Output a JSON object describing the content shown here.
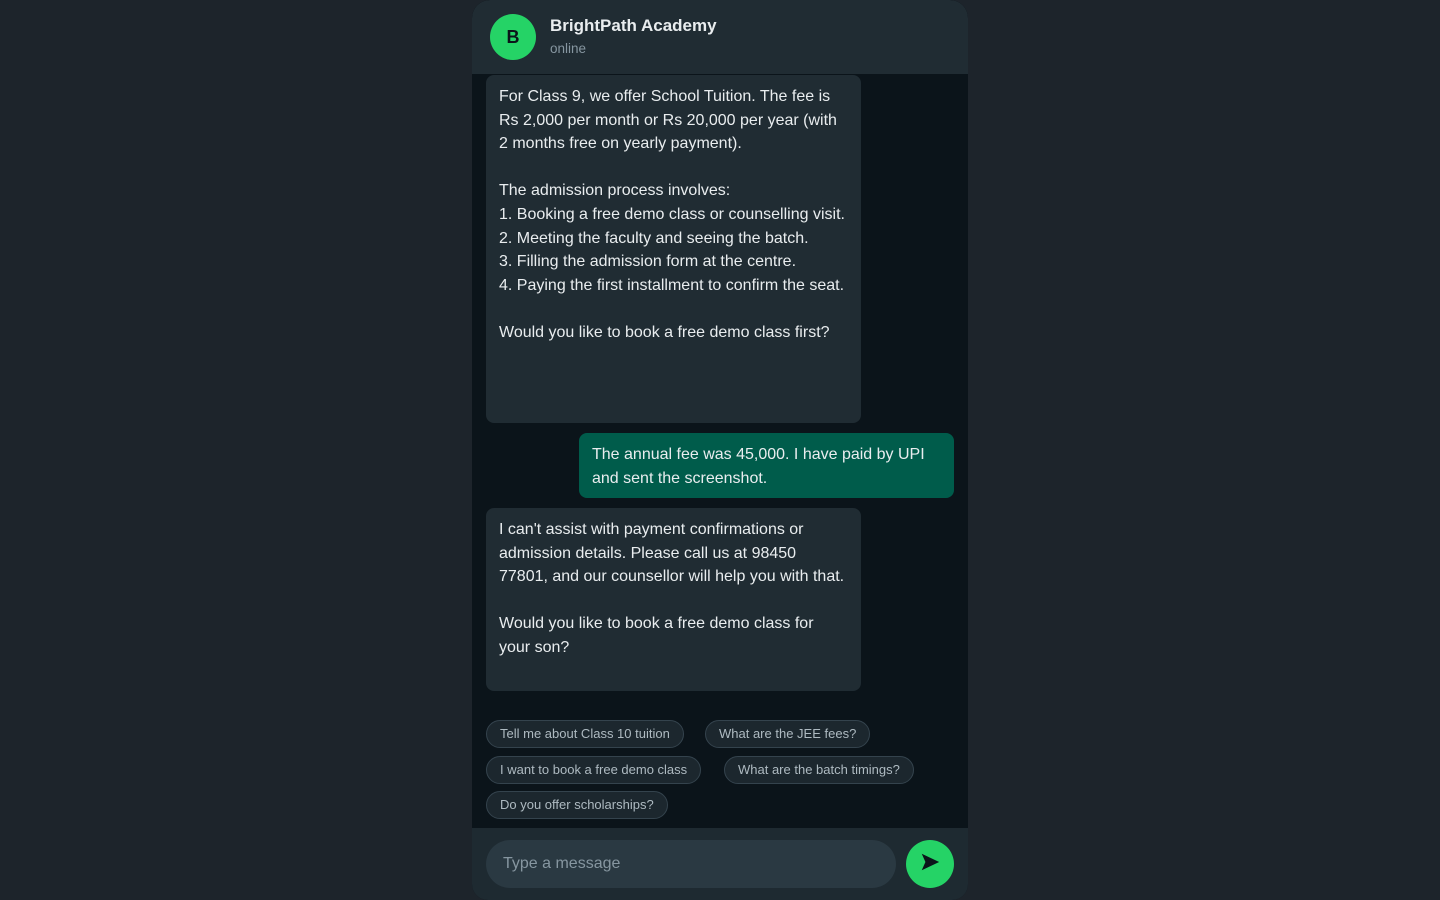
{
  "header": {
    "avatar_letter": "B",
    "title": "BrightPath Academy",
    "status": "online"
  },
  "messages": [
    {
      "from": "bot",
      "text": "For Class 9, we offer School Tuition. The fee is Rs 2,000 per month or Rs 20,000 per year (with 2 months free on yearly payment).\n\nThe admission process involves:\n1. Booking a free demo class or counselling visit.\n2. Meeting the faculty and seeing the batch.\n3. Filling the admission form at the centre.\n4. Paying the first installment to confirm the seat.\n\nWould you like to book a free demo class first?"
    },
    {
      "from": "user",
      "text": "The annual fee was 45,000. I have paid by UPI and sent the screenshot."
    },
    {
      "from": "bot",
      "text": "I can't assist with payment confirmations or admission details. Please call us at 98450 77801, and our counsellor will help you with that.\n\nWould you like to book a free demo class for your son?"
    }
  ],
  "quick_replies": [
    "Tell me about Class 10 tuition",
    "What are the JEE fees?",
    "I want to book a free demo class",
    "What are the batch timings?",
    "Do you offer scholarships?"
  ],
  "composer": {
    "placeholder": "Type a message",
    "send_icon": "send-arrow-icon"
  },
  "colors": {
    "accent": "#25d366",
    "outgoing_bubble": "#005c4b",
    "incoming_bubble": "#202c33",
    "chat_background": "#0b141a"
  }
}
